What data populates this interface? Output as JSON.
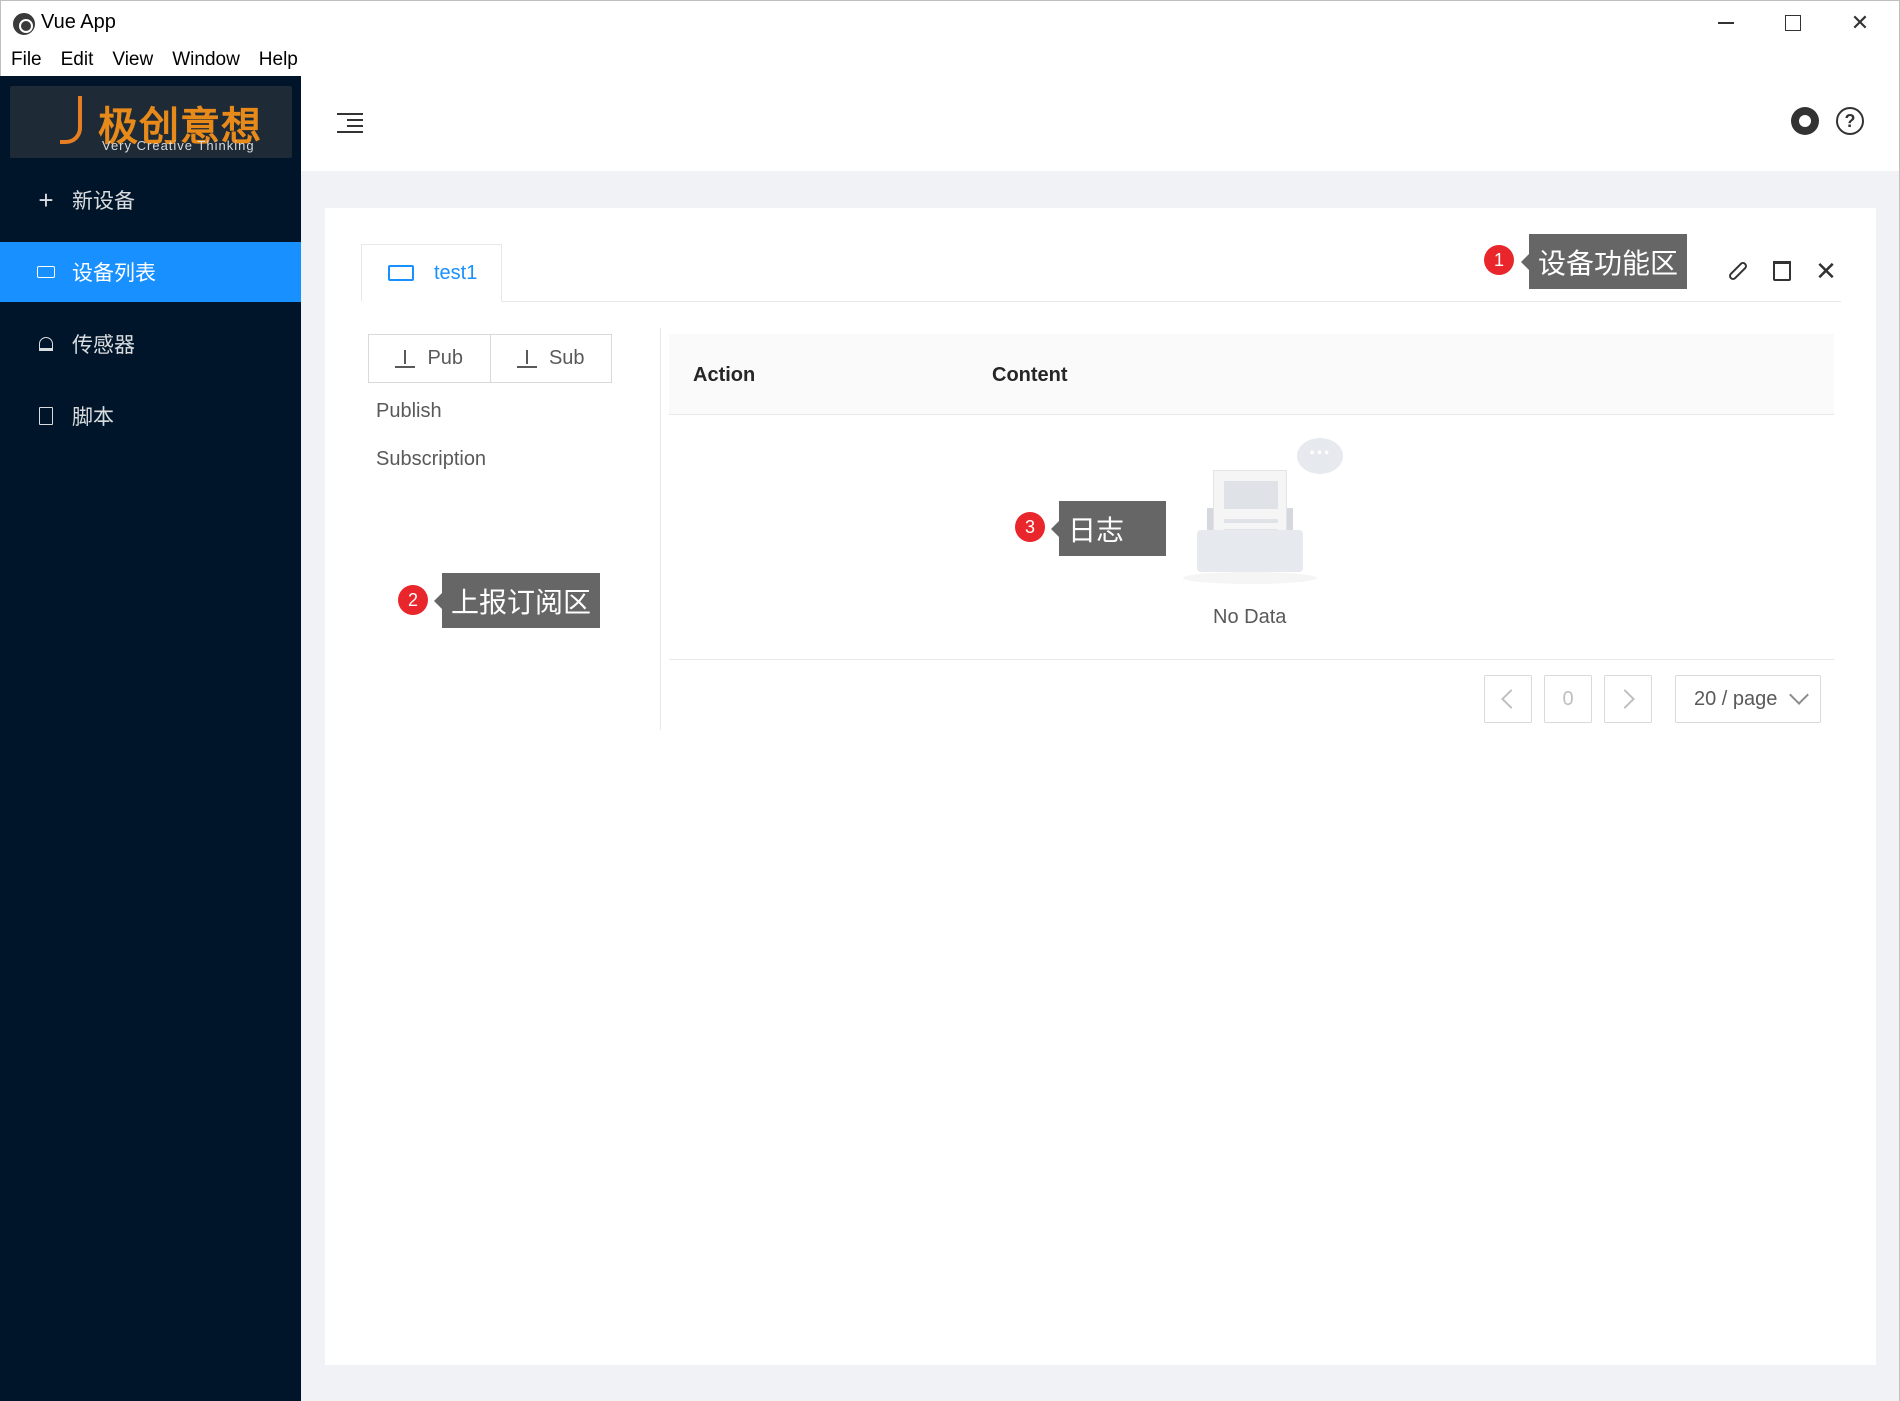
{
  "window": {
    "title": "Vue App"
  },
  "menu": [
    "File",
    "Edit",
    "View",
    "Window",
    "Help"
  ],
  "logo": {
    "brand": "极创意想",
    "tagline": "Very Creative Thinking"
  },
  "sidebar": {
    "items": [
      {
        "label": "新设备",
        "icon": "plus-icon"
      },
      {
        "label": "设备列表",
        "icon": "device-icon",
        "active": true
      },
      {
        "label": "传感器",
        "icon": "alarm-icon"
      },
      {
        "label": "脚本",
        "icon": "file-icon"
      }
    ]
  },
  "tabs": [
    {
      "label": "test1",
      "active": true
    }
  ],
  "pubsub": {
    "pub_label": "Pub",
    "sub_label": "Sub",
    "links": [
      "Publish",
      "Subscription"
    ]
  },
  "table": {
    "columns": [
      "Action",
      "Content"
    ],
    "empty_text": "No Data"
  },
  "pagination": {
    "current": "0",
    "page_size": "20 / page"
  },
  "annotations": [
    {
      "num": "1",
      "text": "设备功能区"
    },
    {
      "num": "2",
      "text": "上报订阅区"
    },
    {
      "num": "3",
      "text": "日志"
    }
  ],
  "colors": {
    "sidebar_bg": "#001529",
    "accent": "#1890ff",
    "badge": "#e8262b"
  }
}
